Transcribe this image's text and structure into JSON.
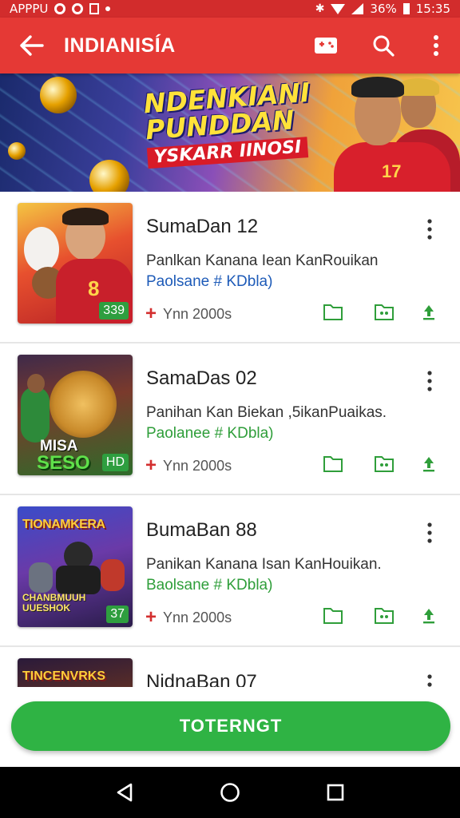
{
  "status_bar": {
    "left_text": "APPPU",
    "battery_percent": "36%",
    "time": "15:35",
    "icons": [
      "circle-icon",
      "circle-icon",
      "sim-icon",
      "dot-icon",
      "bluetooth-icon",
      "wifi-icon",
      "signal-icon",
      "battery-icon"
    ]
  },
  "app_bar": {
    "title": "INDIANISÍA",
    "icons": [
      "back-arrow-icon",
      "gamepad-icon",
      "search-icon",
      "more-vert-icon"
    ]
  },
  "banner": {
    "line1": "NDENKIANI",
    "line2": "PUNDDAN",
    "line3": "YSKARR IINOSI",
    "jersey_number": "17"
  },
  "items": [
    {
      "title": "SumaDan 12",
      "desc": "Panlkan Kanana Iean KanRouikan",
      "sub": "Paolsane # KDbla)",
      "sub_color": "#1e5bb8",
      "meta": "Ynn 2000s",
      "badge": "339",
      "thumb_text": "8",
      "thumb_text2": ""
    },
    {
      "title": "SamaDas 02",
      "desc": "Panihan Kan Biekan ,5ikanPuaikas.",
      "sub": "Paolanee # KDbla)",
      "sub_color": "#2f9e3a",
      "meta": "Ynn 2000s",
      "badge": "HD",
      "thumb_text": "MISA",
      "thumb_text2": "SESO"
    },
    {
      "title": "BumaBan 88",
      "desc": "Panikan Kanana Isan KanHouikan.",
      "sub": "Baolsane # KDbla)",
      "sub_color": "#2f9e3a",
      "meta": "Ynn 2000s",
      "badge": "37",
      "thumb_text": "TIONAMKERA",
      "thumb_text2": "CHANBMUUH UUESHOK"
    },
    {
      "title": "NidnaBan 07",
      "desc": "",
      "sub": "",
      "sub_color": "#2f9e3a",
      "meta": "",
      "badge": "",
      "thumb_text": "TINCENVRKS",
      "thumb_text2": ""
    }
  ],
  "action_icons": [
    "folder-icon",
    "image-folder-icon",
    "download-icon"
  ],
  "bottom_button": {
    "label": "TOTERNGT",
    "color": "#2fb344"
  },
  "nav_bar": {
    "icons": [
      "back-triangle-icon",
      "home-circle-icon",
      "recents-square-icon"
    ]
  },
  "colors": {
    "accent": "#e53935",
    "status": "#d22c2c",
    "green": "#2f9e3a"
  }
}
